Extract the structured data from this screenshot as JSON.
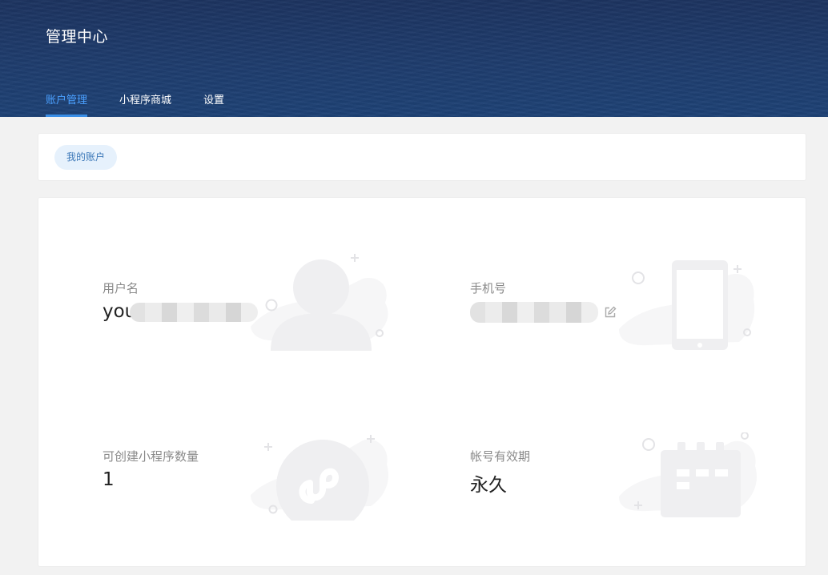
{
  "header": {
    "title": "管理中心",
    "tabs": [
      {
        "label": "账户管理",
        "active": true
      },
      {
        "label": "小程序商城",
        "active": false
      },
      {
        "label": "设置",
        "active": false
      }
    ]
  },
  "account_tabs": {
    "my_account": "我的账户"
  },
  "fields": {
    "username": {
      "label": "用户名",
      "value": "you"
    },
    "phone": {
      "label": "手机号",
      "value": ""
    },
    "miniprogram_quota": {
      "label": "可创建小程序数量",
      "value": "1"
    },
    "validity": {
      "label": "帐号有效期",
      "value": "永久"
    }
  },
  "icons": [
    "user-illustration",
    "phone-illustration",
    "miniprogram-illustration",
    "calendar-illustration",
    "edit-icon"
  ],
  "colors": {
    "header": "#1f3d6e",
    "active_tab": "#4aa0ff",
    "pill_bg": "#e6f1fc",
    "illustration": "#efeff1"
  }
}
